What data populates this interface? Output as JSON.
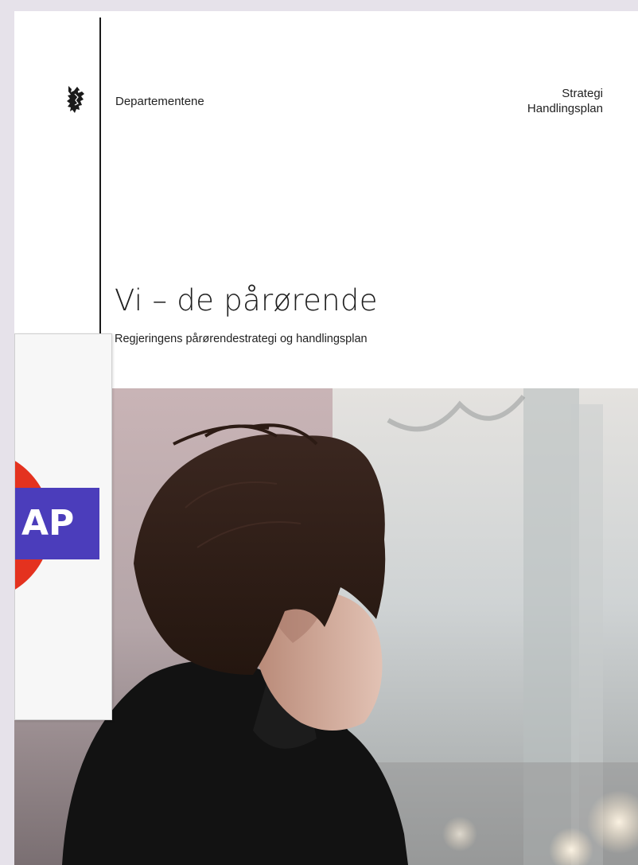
{
  "header": {
    "publisher": "Departementene",
    "doc_type_lines": [
      "Strategi",
      "Handlingsplan"
    ]
  },
  "cover": {
    "title": "Vi – de pårørende",
    "subtitle": "Regjeringens pårørendestrategi og handlingsplan"
  },
  "logo_card": {
    "visible_text": "AP",
    "circle_color": "#e4321f",
    "bar_color": "#4b3dbb"
  },
  "icons": [
    "coat-of-arms-icon"
  ],
  "colors": {
    "page_background": "#e6e2ea",
    "cover_background": "#ffffff",
    "text": "#222222"
  }
}
